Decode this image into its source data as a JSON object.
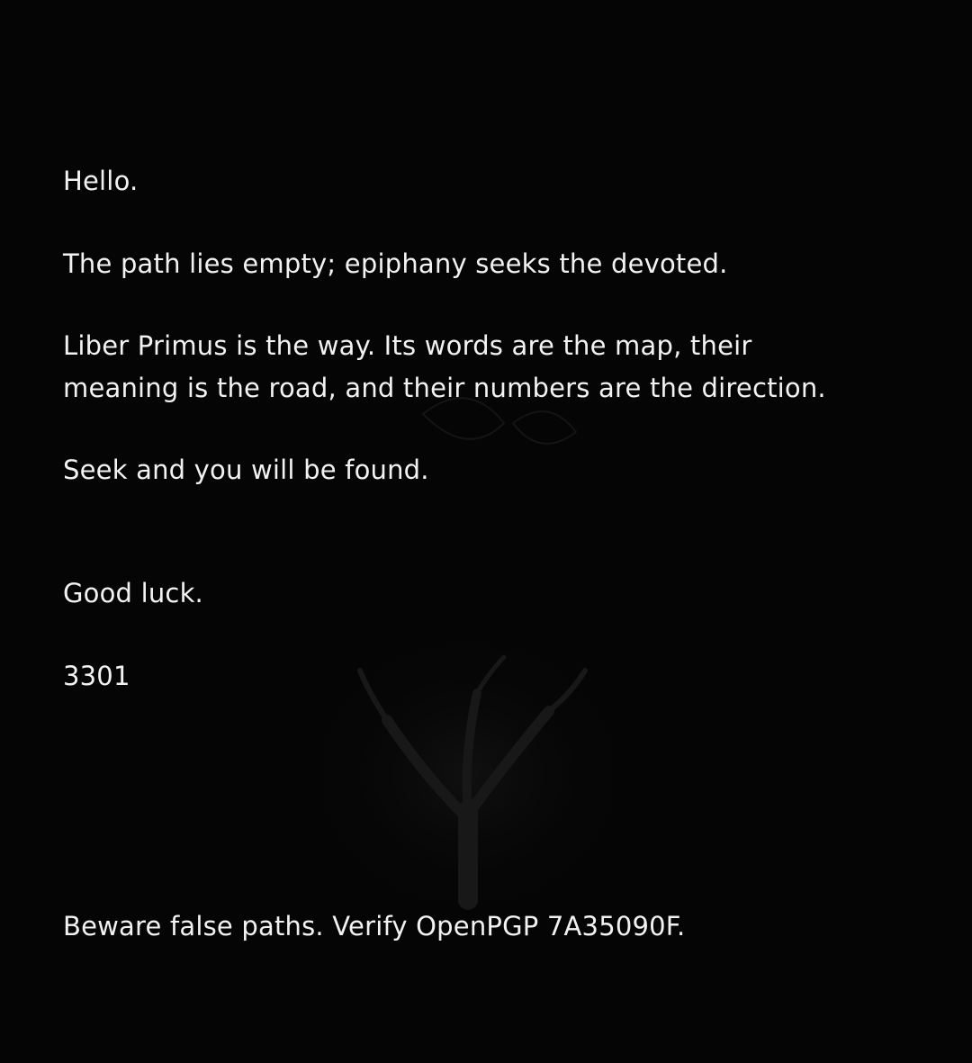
{
  "message": {
    "greeting": "Hello.",
    "line_path": "The path lies empty; epiphany seeks the devoted.",
    "liber_line_1": "Liber Primus is the way.  Its words are the map, their",
    "liber_line_2": "meaning is the road, and their numbers are the direction.",
    "seek": "Seek and you will be found.",
    "good_luck": "Good luck.",
    "signature": "3301",
    "warning": "Beware false paths.  Verify OpenPGP 7A35090F."
  },
  "colors": {
    "background": "#050505",
    "text": "#f2f2f2",
    "watermark": "#1a1a1a"
  },
  "watermark": {
    "icon": "tree-icon"
  }
}
